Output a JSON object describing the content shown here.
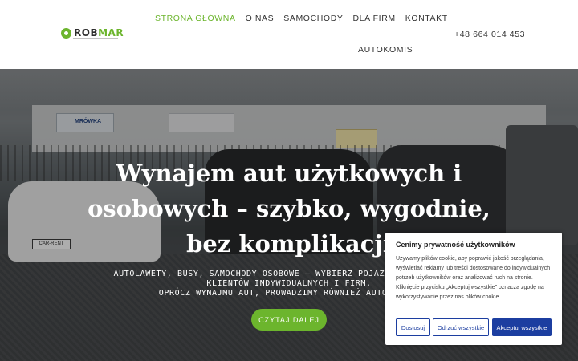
{
  "logo": {
    "text_part1": "ROB",
    "text_part2": "MAR"
  },
  "nav": {
    "items": [
      {
        "label": "STRONA GŁÓWNA",
        "active": true
      },
      {
        "label": "O NAS"
      },
      {
        "label": "SAMOCHODY"
      },
      {
        "label": "DLA FIRM"
      },
      {
        "label": "KONTAKT"
      }
    ],
    "second_row": "AUTOKOMIS"
  },
  "phone": "+48 664 014 453",
  "hero": {
    "title_lines": [
      "Wynajem aut użytkowych i",
      "osobowych – szybko, wygodnie,",
      "bez komplikacji"
    ],
    "subtitle_lines": [
      "AUTOLAWETY, BUSY, SAMOCHODY OSOBOWE – WYBIERZ POJAZD DOPASOWANY DO",
      "KLIENTÓW INDYWIDUALNYCH I FIRM.",
      "OPRÓCZ WYNAJMU AUT, PROWADZIMY RÓWNIEŻ AUTOKOMIS."
    ],
    "cta_label": "CZYTAJ DALEJ",
    "sign_text": "MRÓWKA",
    "plate_text": "CAR-RENT"
  },
  "cookie": {
    "title": "Cenimy prywatność użytkowników",
    "text": "Używamy plików cookie, aby poprawić jakość przeglądania, wyświetlać reklamy lub treści dostosowane do indywidualnych potrzeb użytkowników oraz analizować ruch na stronie. Kliknięcie przycisku „Akceptuj wszystkie” oznacza zgodę na wykorzystywanie przez nas plików cookie.",
    "customize_label": "Dostosuj",
    "reject_label": "Odrzuć wszystkie",
    "accept_label": "Akceptuj wszystkie"
  },
  "colors": {
    "accent": "#6cb52d",
    "cookie_primary": "#1c3ea0"
  }
}
